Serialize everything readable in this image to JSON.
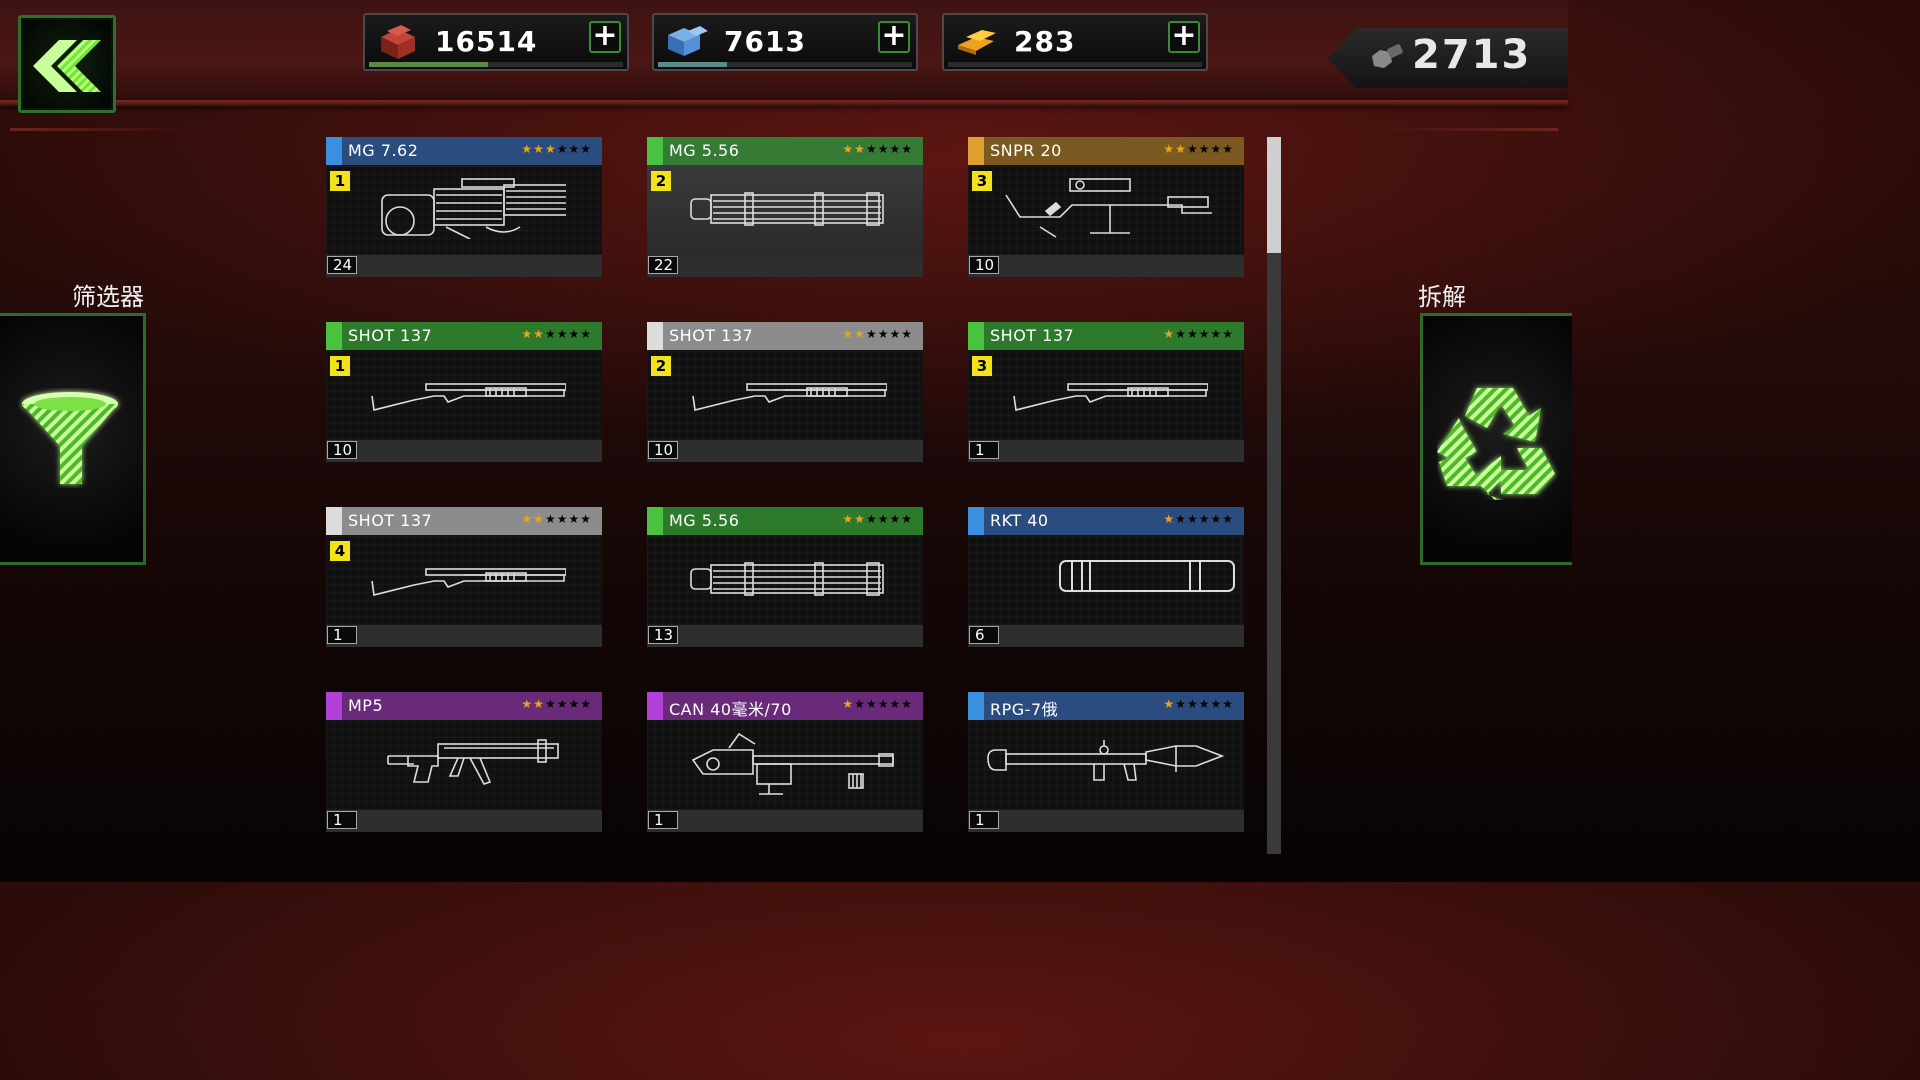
{
  "header": {
    "back_icon": "chevron-double-left-icon",
    "resources": [
      {
        "name": "cash",
        "icon": "red-crate-icon",
        "value": "16514",
        "fill": 0.47,
        "bar_color": "#5a8a44"
      },
      {
        "name": "supplies",
        "icon": "blue-crate-icon",
        "value": "7613",
        "fill": 0.27,
        "bar_color": "#5b8a8a"
      },
      {
        "name": "gold",
        "icon": "gold-bars-icon",
        "value": "283",
        "fill": 0.0,
        "bar_color": "#888888"
      }
    ],
    "parts": {
      "icon": "bolt-nut-icon",
      "value": "2713"
    }
  },
  "filter": {
    "label": "筛选器",
    "icon": "funnel-icon"
  },
  "dismantle": {
    "label": "拆解",
    "icon": "recycle-icon"
  },
  "cards": [
    {
      "name": "MG 7.62",
      "color": "#2b4c7f",
      "stripe": "#3a8fe0",
      "stars": 3,
      "level": "1",
      "count": "24",
      "weapon": "gatling-heavy"
    },
    {
      "name": "MG 5.56",
      "color": "#357a35",
      "stripe": "#49c23f",
      "stars": 2,
      "level": "2",
      "count": "22",
      "weapon": "minigun",
      "selected": true
    },
    {
      "name": "SNPR 20",
      "color": "#7a5a20",
      "stripe": "#e0a030",
      "stars": 2,
      "level": "3",
      "count": "10",
      "weapon": "sniper"
    },
    {
      "name": "SHOT 137",
      "color": "#2d7a2d",
      "stripe": "#49c23f",
      "stars": 2,
      "level": "1",
      "count": "10",
      "weapon": "shotgun"
    },
    {
      "name": "SHOT 137",
      "color": "#8c8c8c",
      "stripe": "#dcdcdc",
      "stars": 2,
      "level": "2",
      "count": "10",
      "weapon": "shotgun"
    },
    {
      "name": "SHOT 137",
      "color": "#2d7a2d",
      "stripe": "#49c23f",
      "stars": 1,
      "level": "3",
      "count": "1",
      "weapon": "shotgun"
    },
    {
      "name": "SHOT 137",
      "color": "#8c8c8c",
      "stripe": "#dcdcdc",
      "stars": 2,
      "level": "4",
      "count": "1",
      "weapon": "shotgun"
    },
    {
      "name": "MG 5.56",
      "color": "#2d7a2d",
      "stripe": "#49c23f",
      "stars": 2,
      "level": "",
      "count": "13",
      "weapon": "minigun"
    },
    {
      "name": "RKT 40",
      "color": "#2b4c7f",
      "stripe": "#3a8fe0",
      "stars": 1,
      "level": "",
      "count": "6",
      "weapon": "rocket-tube"
    },
    {
      "name": "MP5",
      "color": "#6a2a7a",
      "stripe": "#b040d8",
      "stars": 2,
      "level": "",
      "count": "1",
      "weapon": "smg"
    },
    {
      "name": "CAN 40毫米/70",
      "color": "#6a2a7a",
      "stripe": "#b040d8",
      "stars": 1,
      "level": "",
      "count": "1",
      "weapon": "cannon"
    },
    {
      "name": "RPG-7俄",
      "color": "#2b4c7f",
      "stripe": "#3a8fe0",
      "stars": 1,
      "level": "",
      "count": "1",
      "weapon": "rpg"
    }
  ],
  "scroll": {
    "position": 0.0
  }
}
